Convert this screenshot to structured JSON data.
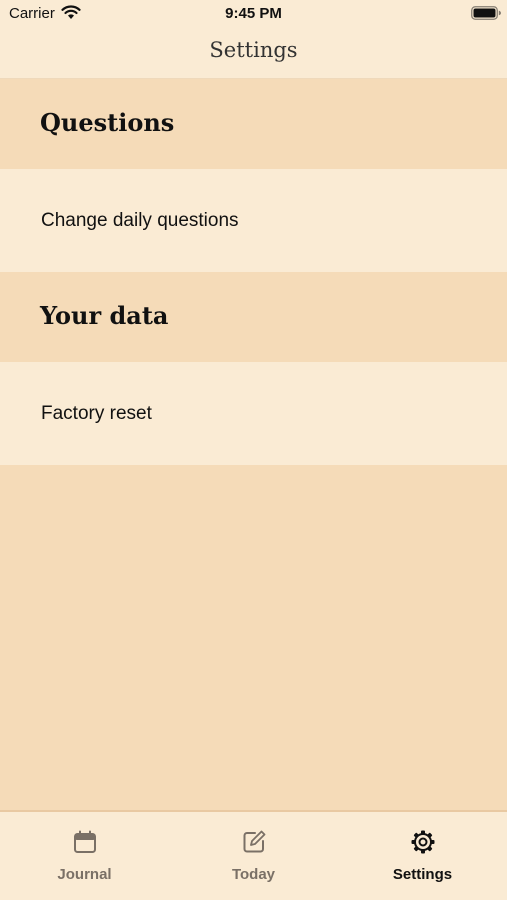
{
  "status_bar": {
    "carrier": "Carrier",
    "time": "9:45 PM",
    "wifi_icon": "wifi-icon",
    "battery_icon": "battery-full-icon"
  },
  "nav": {
    "title": "Settings"
  },
  "sections": [
    {
      "header": "Questions",
      "rows": [
        {
          "label": "Change daily questions"
        }
      ]
    },
    {
      "header": "Your data",
      "rows": [
        {
          "label": "Factory reset"
        }
      ]
    }
  ],
  "tab_bar": {
    "tabs": [
      {
        "label": "Journal",
        "icon": "calendar-icon",
        "active": false
      },
      {
        "label": "Today",
        "icon": "edit-icon",
        "active": false
      },
      {
        "label": "Settings",
        "icon": "gear-icon",
        "active": true
      }
    ]
  },
  "colors": {
    "background": "#f5dbb8",
    "row_background": "#faebd4",
    "active_tab": "#111111",
    "inactive_tab": "#7a7066"
  }
}
